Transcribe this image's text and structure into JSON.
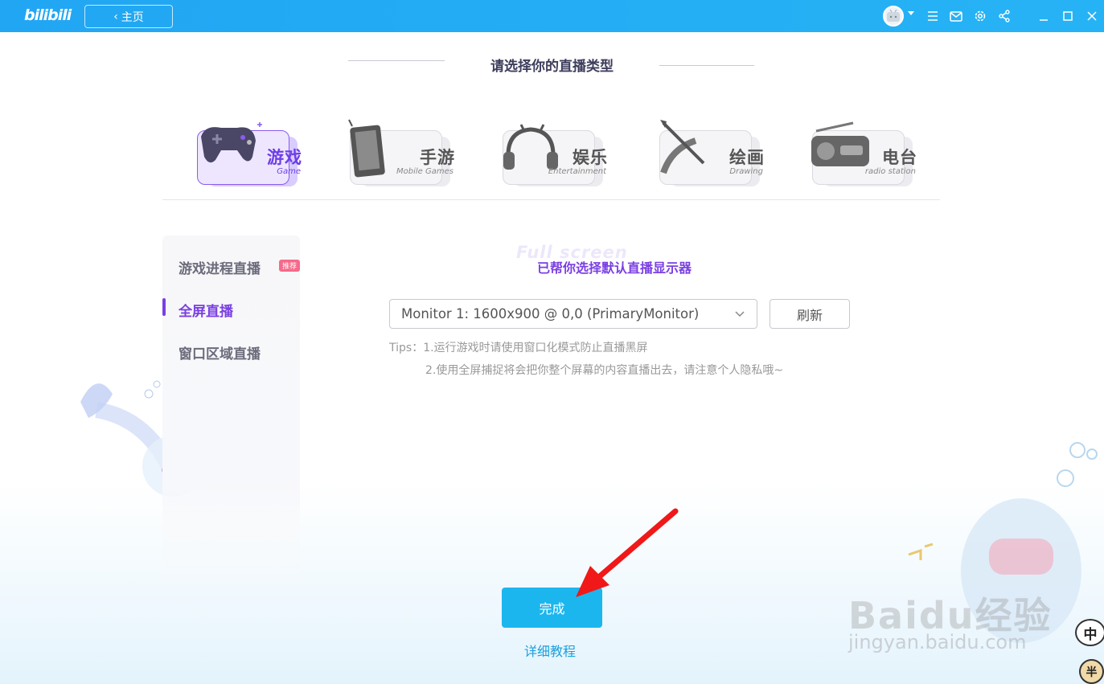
{
  "app": {
    "logo_text": "bilibili",
    "home_button": "主页"
  },
  "titlebar_icons": [
    "avatar",
    "menu-icon",
    "mail-icon",
    "gear-icon",
    "share-icon",
    "minimize-icon",
    "maximize-icon",
    "close-icon"
  ],
  "header": {
    "title": "请选择你的直播类型"
  },
  "categories": [
    {
      "name": "游戏",
      "sub": "Game",
      "active": true
    },
    {
      "name": "手游",
      "sub": "Mobile Games",
      "active": false
    },
    {
      "name": "娱乐",
      "sub": "Entertainment",
      "active": false
    },
    {
      "name": "绘画",
      "sub": "Drawing",
      "active": false
    },
    {
      "name": "电台",
      "sub": "radio station",
      "active": false
    }
  ],
  "sidebar": {
    "items": [
      {
        "label": "游戏进程直播",
        "badge": "推荐"
      },
      {
        "label": "全屏直播",
        "active": true
      },
      {
        "label": "窗口区域直播"
      }
    ]
  },
  "main": {
    "ghost_text": "Full screen",
    "subtitle": "已帮你选择默认直播显示器",
    "monitor_select_value": "Monitor 1: 1600x900 @ 0,0 (PrimaryMonitor)",
    "refresh_label": "刷新",
    "tip_line1": "Tips：1.运行游戏时请使用窗口化模式防止直播黑屏",
    "tip_line2": "2.使用全屏捕捉将会把你整个屏幕的内容直播出去，请注意个人隐私哦~",
    "done_label": "完成",
    "tutorial_label": "详细教程"
  },
  "watermark": {
    "line1": "Baidu经验",
    "line2": "jingyan.baidu.com"
  },
  "ime": {
    "label": "中",
    "label2": "半"
  },
  "colors": {
    "titlebar": "#23aaf2",
    "accent_purple": "#7a3fe3",
    "done_button": "#1cb6ee",
    "badge": "#f56a8a"
  }
}
